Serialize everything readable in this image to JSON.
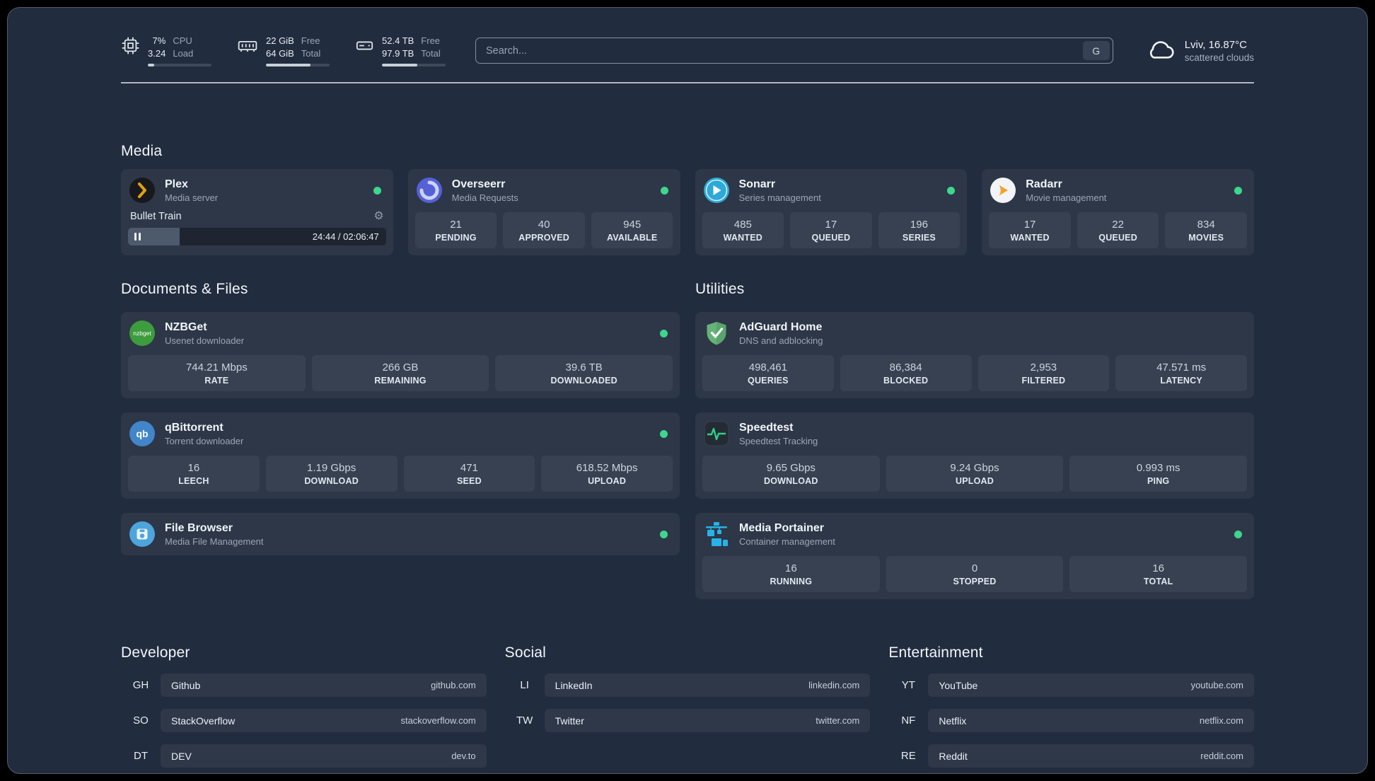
{
  "topbar": {
    "cpu": {
      "value_top": "7%",
      "value_bottom": "3.24",
      "label_top": "CPU",
      "label_bottom": "Load",
      "bar": "10%"
    },
    "memory": {
      "value_top": "22 GiB",
      "value_bottom": "64 GiB",
      "label_top": "Free",
      "label_bottom": "Total",
      "bar": "70%"
    },
    "disk": {
      "value_top": "52.4 TB",
      "value_bottom": "97.9 TB",
      "label_top": "Free",
      "label_bottom": "Total",
      "bar": "55%"
    },
    "search": {
      "placeholder": "Search...",
      "button": "G"
    },
    "weather": {
      "location": "Lviv, 16.87°C",
      "condition": "scattered clouds"
    }
  },
  "icons": {
    "gear": "⚙"
  },
  "section_titles": {
    "media": "Media",
    "documents": "Documents & Files",
    "utilities": "Utilities"
  },
  "services": {
    "plex": {
      "name": "Plex",
      "subtitle": "Media server",
      "status": "online",
      "player": {
        "title": "Bullet Train",
        "time": "24:44 / 02:06:47",
        "progress": "20%"
      }
    },
    "overseerr": {
      "name": "Overseerr",
      "subtitle": "Media Requests",
      "status": "online",
      "stats": [
        {
          "value": "21",
          "label": "PENDING"
        },
        {
          "value": "40",
          "label": "APPROVED"
        },
        {
          "value": "945",
          "label": "AVAILABLE"
        }
      ]
    },
    "sonarr": {
      "name": "Sonarr",
      "subtitle": "Series management",
      "status": "online",
      "stats": [
        {
          "value": "485",
          "label": "WANTED"
        },
        {
          "value": "17",
          "label": "QUEUED"
        },
        {
          "value": "196",
          "label": "SERIES"
        }
      ]
    },
    "radarr": {
      "name": "Radarr",
      "subtitle": "Movie management",
      "status": "online",
      "stats": [
        {
          "value": "17",
          "label": "WANTED"
        },
        {
          "value": "22",
          "label": "QUEUED"
        },
        {
          "value": "834",
          "label": "MOVIES"
        }
      ]
    },
    "nzbget": {
      "name": "NZBGet",
      "subtitle": "Usenet downloader",
      "status": "online",
      "icon_text": "nzbget",
      "stats": [
        {
          "value": "744.21 Mbps",
          "label": "RATE"
        },
        {
          "value": "266 GB",
          "label": "REMAINING"
        },
        {
          "value": "39.6 TB",
          "label": "DOWNLOADED"
        }
      ]
    },
    "qbittorrent": {
      "name": "qBittorrent",
      "subtitle": "Torrent downloader",
      "status": "online",
      "icon_text": "qb",
      "stats": [
        {
          "value": "16",
          "label": "LEECH"
        },
        {
          "value": "1.19 Gbps",
          "label": "DOWNLOAD"
        },
        {
          "value": "471",
          "label": "SEED"
        },
        {
          "value": "618.52 Mbps",
          "label": "UPLOAD"
        }
      ]
    },
    "filebrowser": {
      "name": "File Browser",
      "subtitle": "Media File Management",
      "status": "online"
    },
    "adguard": {
      "name": "AdGuard Home",
      "subtitle": "DNS and adblocking",
      "stats": [
        {
          "value": "498,461",
          "label": "QUERIES"
        },
        {
          "value": "86,384",
          "label": "BLOCKED"
        },
        {
          "value": "2,953",
          "label": "FILTERED"
        },
        {
          "value": "47.571 ms",
          "label": "LATENCY"
        }
      ]
    },
    "speedtest": {
      "name": "Speedtest",
      "subtitle": "Speedtest Tracking",
      "stats": [
        {
          "value": "9.65 Gbps",
          "label": "DOWNLOAD"
        },
        {
          "value": "9.24 Gbps",
          "label": "UPLOAD"
        },
        {
          "value": "0.993 ms",
          "label": "PING"
        }
      ]
    },
    "portainer": {
      "name": "Media Portainer",
      "subtitle": "Container management",
      "status": "online",
      "stats": [
        {
          "value": "16",
          "label": "RUNNING"
        },
        {
          "value": "0",
          "label": "STOPPED"
        },
        {
          "value": "16",
          "label": "TOTAL"
        }
      ]
    }
  },
  "bookmarks": {
    "developer": {
      "title": "Developer",
      "items": [
        {
          "abbr": "GH",
          "name": "Github",
          "domain": "github.com"
        },
        {
          "abbr": "SO",
          "name": "StackOverflow",
          "domain": "stackoverflow.com"
        },
        {
          "abbr": "DT",
          "name": "DEV",
          "domain": "dev.to"
        }
      ]
    },
    "social": {
      "title": "Social",
      "items": [
        {
          "abbr": "LI",
          "name": "LinkedIn",
          "domain": "linkedin.com"
        },
        {
          "abbr": "TW",
          "name": "Twitter",
          "domain": "twitter.com"
        }
      ]
    },
    "entertainment": {
      "title": "Entertainment",
      "items": [
        {
          "abbr": "YT",
          "name": "YouTube",
          "domain": "youtube.com"
        },
        {
          "abbr": "NF",
          "name": "Netflix",
          "domain": "netflix.com"
        },
        {
          "abbr": "RE",
          "name": "Reddit",
          "domain": "reddit.com"
        }
      ]
    }
  },
  "colors": {
    "background": "#212c3e",
    "status_online": "#3ed68d",
    "plex_amber": "#e5a00d",
    "overseerr_purple": "#5561d6",
    "sonarr_blue": "#2da8d8",
    "radarr_amber": "#f0a32e",
    "nzbget_green": "#3d9c3d",
    "qbittorrent_blue": "#4285c9",
    "filebrowser_blue": "#4da5dc",
    "adguard_green": "#67b279",
    "speedtest_green": "#2fd089",
    "portainer_blue": "#27b3e8"
  }
}
